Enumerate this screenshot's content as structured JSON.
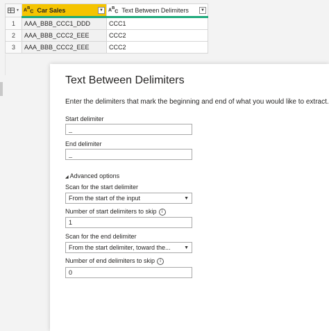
{
  "grid": {
    "columns": [
      {
        "type_icon": "ABC",
        "label": "Car Sales"
      },
      {
        "type_icon": "ABC",
        "label": "Text Between Delimiters"
      }
    ],
    "rows": [
      {
        "num": "1",
        "car_sales": "AAA_BBB_CCC1_DDD",
        "between": "CCC1"
      },
      {
        "num": "2",
        "car_sales": "AAA_BBB_CCC2_EEE",
        "between": "CCC2"
      },
      {
        "num": "3",
        "car_sales": "AAA_BBB_CCC2_EEE",
        "between": "CCC2"
      }
    ]
  },
  "dialog": {
    "title": "Text Between Delimiters",
    "description": "Enter the delimiters that mark the beginning and end of what you would like to extract.",
    "start_delimiter_label": "Start delimiter",
    "start_delimiter_value": "_",
    "end_delimiter_label": "End delimiter",
    "end_delimiter_value": "_",
    "advanced_label": "Advanced options",
    "scan_start_label": "Scan for the start delimiter",
    "scan_start_value": "From the start of the input",
    "skip_start_label": "Number of start delimiters to skip",
    "skip_start_value": "1",
    "scan_end_label": "Scan for the end delimiter",
    "scan_end_value": "From the start delimiter, toward the...",
    "skip_end_label": "Number of end delimiters to skip",
    "skip_end_value": "0"
  }
}
